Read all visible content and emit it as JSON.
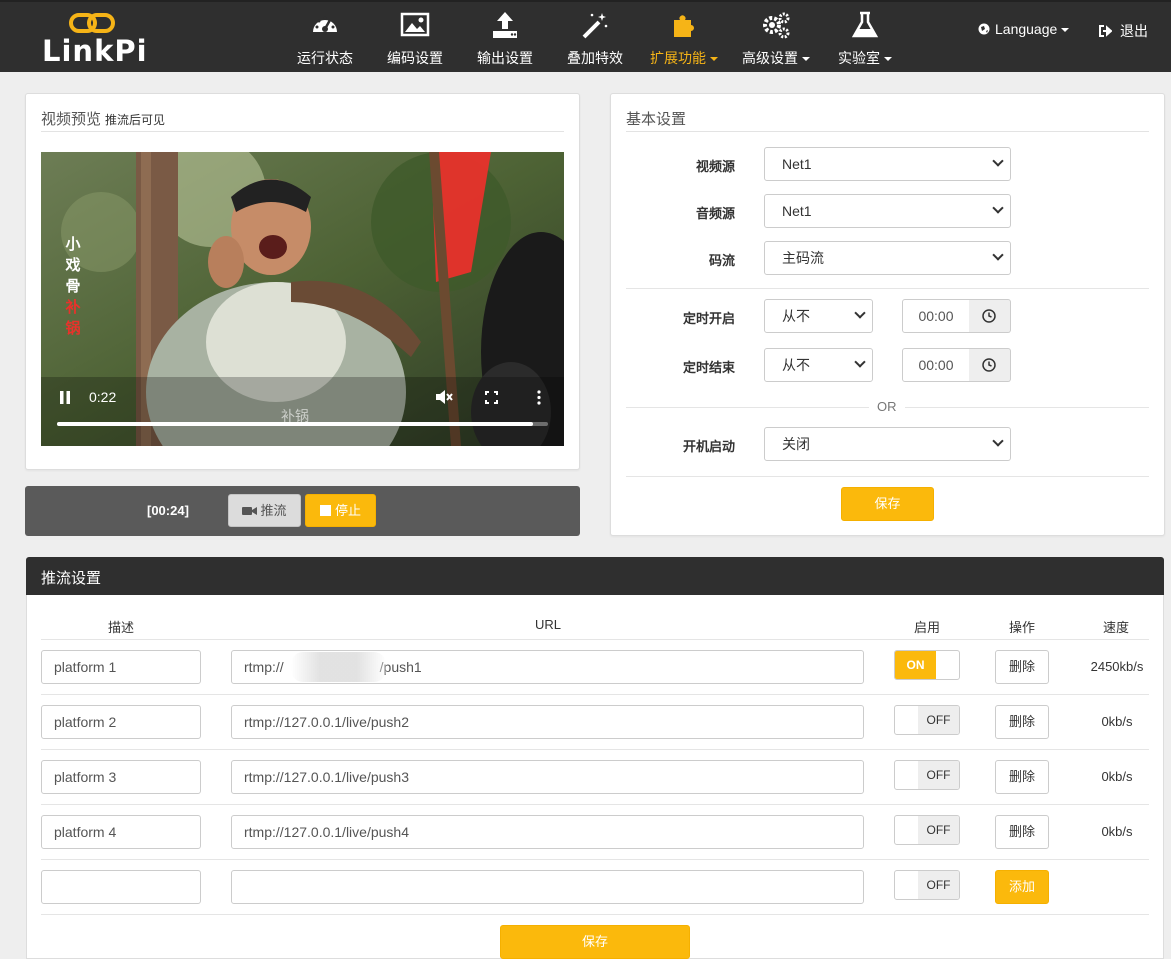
{
  "brand": {
    "name": "LinkPi"
  },
  "nav": {
    "items": [
      {
        "label": "运行状态",
        "icon": "dashboard-icon"
      },
      {
        "label": "编码设置",
        "icon": "image-icon"
      },
      {
        "label": "输出设置",
        "icon": "upload-icon"
      },
      {
        "label": "叠加特效",
        "icon": "magic-wand-icon"
      },
      {
        "label": "扩展功能",
        "icon": "puzzle-icon",
        "active": true
      },
      {
        "label": "高级设置",
        "icon": "gears-icon"
      },
      {
        "label": "实验室",
        "icon": "flask-icon"
      }
    ],
    "language": "Language",
    "logout": "退出"
  },
  "preview": {
    "title": "视频预览",
    "subtitle": "推流后可见",
    "time": "0:22",
    "progress": 0.97,
    "vertical_caption": [
      "小",
      "戏",
      "骨",
      "补",
      "锅"
    ],
    "watermark": "补锅"
  },
  "push_control": {
    "timer": "[00:24]",
    "push_label": "推流",
    "stop_label": "停止"
  },
  "basic": {
    "title": "基本设置",
    "video_source_label": "视频源",
    "video_source": "Net1",
    "audio_source_label": "音频源",
    "audio_source": "Net1",
    "stream_label": "码流",
    "stream": "主码流",
    "timer_on_label": "定时开启",
    "timer_on_mode": "从不",
    "timer_on_time": "00:00",
    "timer_off_label": "定时结束",
    "timer_off_mode": "从不",
    "timer_off_time": "00:00",
    "or": "OR",
    "boot_label": "开机启动",
    "boot": "关闭",
    "save": "保存"
  },
  "streams": {
    "title": "推流设置",
    "headers": {
      "desc": "描述",
      "url": "URL",
      "enable": "启用",
      "action": "操作",
      "speed": "速度"
    },
    "rows": [
      {
        "desc": "platform 1",
        "url_prefix": "rtmp://",
        "url_suffix": "/push1",
        "enabled": true,
        "on": "ON",
        "delete": "删除",
        "speed": "2450kb/s"
      },
      {
        "desc": "platform 2",
        "url": "rtmp://127.0.0.1/live/push2",
        "enabled": false,
        "off": "OFF",
        "delete": "删除",
        "speed": "0kb/s"
      },
      {
        "desc": "platform 3",
        "url": "rtmp://127.0.0.1/live/push3",
        "enabled": false,
        "off": "OFF",
        "delete": "删除",
        "speed": "0kb/s"
      },
      {
        "desc": "platform 4",
        "url": "rtmp://127.0.0.1/live/push4",
        "enabled": false,
        "off": "OFF",
        "delete": "删除",
        "speed": "0kb/s"
      }
    ],
    "new_row": {
      "desc": "",
      "url": "",
      "off": "OFF",
      "add": "添加"
    },
    "save": "保存"
  },
  "colors": {
    "accent": "#fbb90c",
    "nav_bg": "#2f2f2f",
    "active_nav": "#f6b417"
  }
}
